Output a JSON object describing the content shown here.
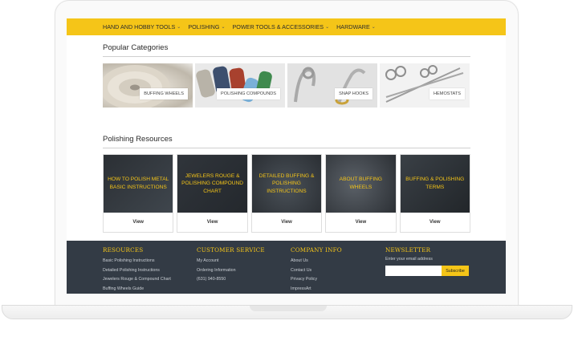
{
  "nav": {
    "items": [
      {
        "label": "HAND AND HOBBY TOOLS"
      },
      {
        "label": "POLISHING"
      },
      {
        "label": "POWER TOOLS & ACCESSORIES"
      },
      {
        "label": "HARDWARE"
      }
    ]
  },
  "popular": {
    "title": "Popular Categories",
    "items": [
      {
        "label": "BUFFING WHEELS"
      },
      {
        "label": "POLISHING COMPOUNDS"
      },
      {
        "label": "SNAP HOOKS"
      },
      {
        "label": "HEMOSTATS"
      }
    ]
  },
  "resources": {
    "title": "Polishing Resources",
    "view_label": "View",
    "items": [
      {
        "title": "HOW TO POLISH METAL BASIC INSTRUCTIONS"
      },
      {
        "title": "JEWELERS ROUGE & POLISHING COMPOUND CHART"
      },
      {
        "title": "DETAILED BUFFING & POLISHING INSTRUCTIONS"
      },
      {
        "title": "ABOUT BUFFING WHEELS"
      },
      {
        "title": "BUFFING & POLISHING TERMS"
      }
    ]
  },
  "footer": {
    "resources": {
      "title": "RESOURCES",
      "links": [
        "Basic Polishing Instructions",
        "Detailed Polishing Instructions",
        "Jewelers Rouge & Compound Chart",
        "Buffing Wheels Guide"
      ]
    },
    "customer_service": {
      "title": "CUSTOMER SERVICE",
      "links": [
        "My Account",
        "Ordering Information",
        "(631) 940-8550"
      ]
    },
    "company": {
      "title": "COMPANY INFO",
      "links": [
        "About Us",
        "Contact Us",
        "Privacy Policy",
        "ImpressArt"
      ]
    },
    "newsletter": {
      "title": "NEWSLETTER",
      "label": "Enter your email address",
      "button": "Subscribe"
    }
  },
  "colors": {
    "accent": "#f5c518",
    "footer_bg": "#333b45"
  }
}
